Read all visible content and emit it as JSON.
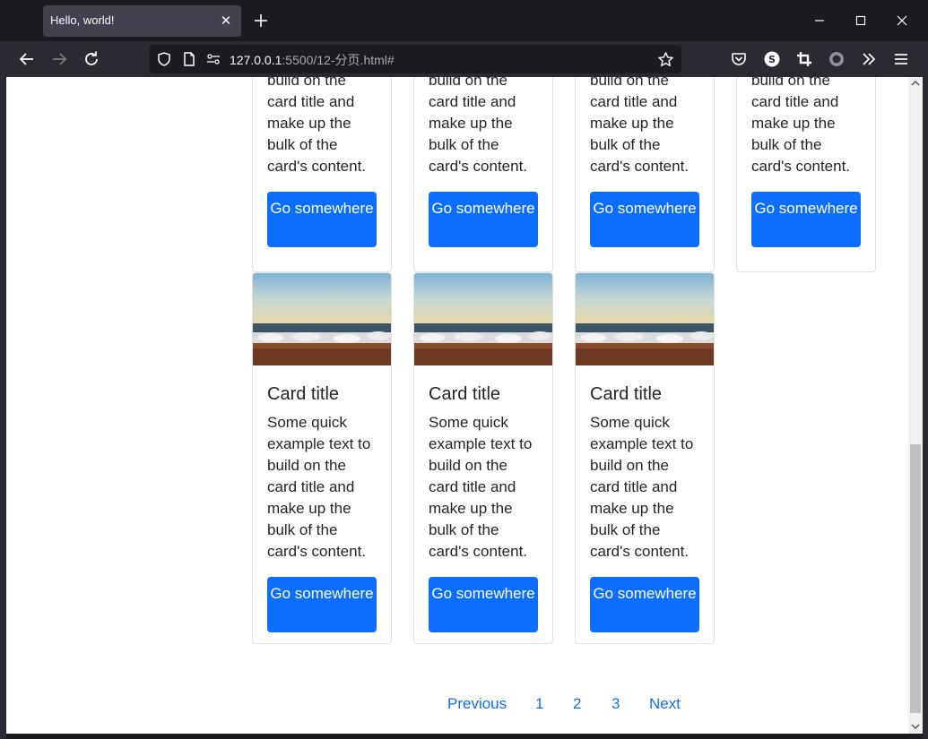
{
  "browser": {
    "tab_title": "Hello, world!",
    "url_host": "127.0.0.1",
    "url_rest": ":5500/12-分页.html#"
  },
  "cards_top": [
    {
      "text": "build on the card title and make up the bulk of the card's content.",
      "button": "Go somewhere"
    },
    {
      "text": "build on the card title and make up the bulk of the card's content.",
      "button": "Go somewhere"
    },
    {
      "text": "build on the card title and make up the bulk of the card's content.",
      "button": "Go somewhere"
    },
    {
      "text": "build on the card title and make up the bulk of the card's content.",
      "button": "Go somewhere"
    }
  ],
  "cards_bottom": [
    {
      "title": "Card title",
      "text": "Some quick example text to build on the card title and make up the bulk of the card's content.",
      "button": "Go somewhere"
    },
    {
      "title": "Card title",
      "text": "Some quick example text to build on the card title and make up the bulk of the card's content.",
      "button": "Go somewhere"
    },
    {
      "title": "Card title",
      "text": "Some quick example text to build on the card title and make up the bulk of the card's content.",
      "button": "Go somewhere"
    }
  ],
  "pagination": {
    "previous": "Previous",
    "pages": [
      "1",
      "2",
      "3"
    ],
    "next": "Next"
  },
  "colors": {
    "primary": "#0d6efd",
    "tab_bg": "#42414d",
    "toolbar_bg": "#2b2a33",
    "chrome_bg": "#1c1b22"
  },
  "icons": {
    "back": "arrow-left-icon",
    "forward": "arrow-right-icon",
    "reload": "reload-icon",
    "shield": "shield-icon",
    "page": "page-icon",
    "permissions": "permissions-icon",
    "bookmark": "star-icon",
    "pocket": "pocket-icon",
    "account": "account-icon",
    "crop": "crop-icon",
    "extension": "circle-icon",
    "overflow": "chevrons-right-icon",
    "menu": "hamburger-icon"
  }
}
